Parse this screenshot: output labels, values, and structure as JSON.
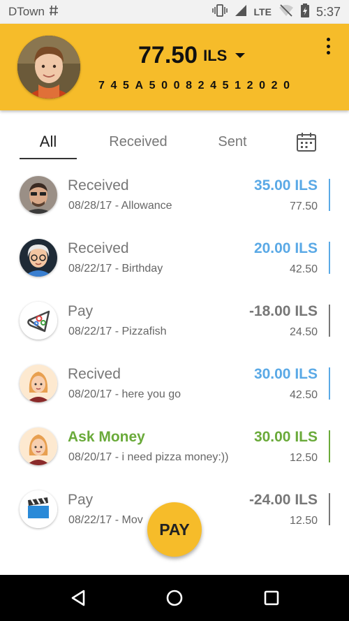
{
  "status_bar": {
    "carrier": "DTown",
    "network": "LTE",
    "time": "5:37",
    "icons": [
      "hash-icon",
      "vibrate-icon",
      "signal-icon",
      "wifi-off-icon",
      "battery-icon"
    ]
  },
  "header": {
    "balance_amount": "77.50",
    "balance_currency": "ILS",
    "account_number": "745A500824512020",
    "menu_icon": "more-vert-icon"
  },
  "tabs": [
    {
      "label": "All",
      "active": true
    },
    {
      "label": "Received",
      "active": false
    },
    {
      "label": "Sent",
      "active": false
    }
  ],
  "calendar_icon": "calendar-icon",
  "transactions": [
    {
      "title": "Received",
      "subtitle": "08/28/17 - Allowance",
      "amount": "35.00 ILS",
      "balance": "77.50",
      "color": "#5aa9e6",
      "avatar": "man-sunglasses"
    },
    {
      "title": "Received",
      "subtitle": "08/22/17 - Birthday",
      "amount": "20.00 ILS",
      "balance": "42.50",
      "color": "#5aa9e6",
      "avatar": "grandma"
    },
    {
      "title": "Pay",
      "subtitle": "08/22/17 - Pizzafish",
      "amount": "-18.00 ILS",
      "balance": "24.50",
      "color": "#777777",
      "avatar": "pizza"
    },
    {
      "title": "Recived",
      "subtitle": "08/20/17 - here you go",
      "amount": "30.00 ILS",
      "balance": "42.50",
      "color": "#5aa9e6",
      "avatar": "woman"
    },
    {
      "title": "Ask Money",
      "subtitle": "08/20/17 - i need pizza money:))",
      "amount": "30.00 ILS",
      "balance": "12.50",
      "color": "#6aaa3a",
      "avatar": "woman"
    },
    {
      "title": "Pay",
      "subtitle": "08/22/17 - Mov",
      "amount": "-24.00 ILS",
      "balance": "12.50",
      "color": "#777777",
      "avatar": "clapperboard"
    }
  ],
  "pay_button": {
    "label": "PAY"
  },
  "nav": {
    "back": "back-icon",
    "home": "home-icon",
    "recents": "recents-icon"
  },
  "colors": {
    "accent": "#f6bc2a",
    "received": "#5aa9e6",
    "ask": "#6aaa3a",
    "pay": "#777777"
  }
}
